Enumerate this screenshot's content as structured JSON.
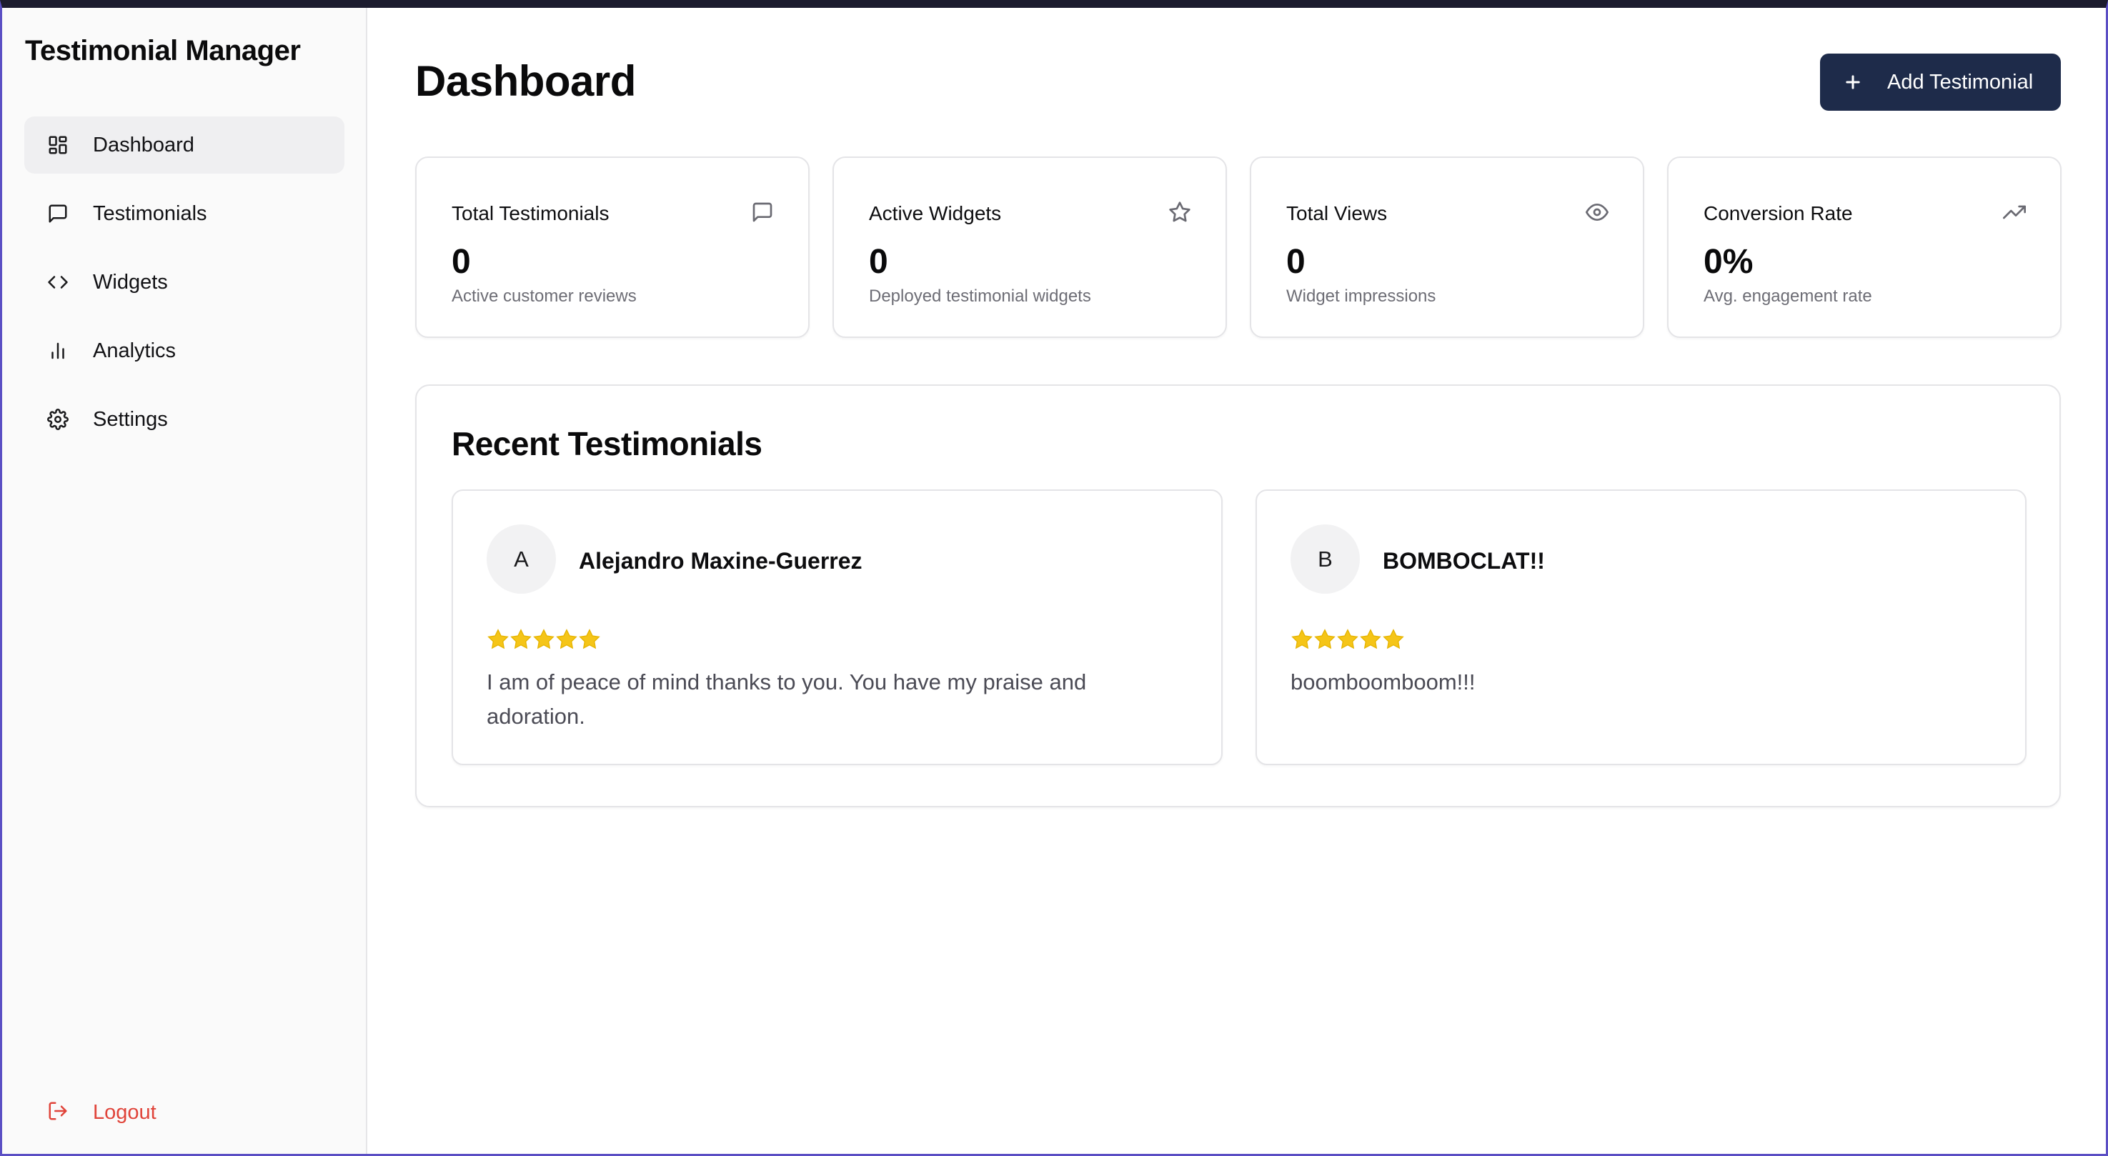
{
  "app": {
    "title": "Testimonial Manager"
  },
  "sidebar": {
    "items": [
      {
        "label": "Dashboard",
        "icon": "dashboard-grid-icon",
        "active": true
      },
      {
        "label": "Testimonials",
        "icon": "message-square-icon",
        "active": false
      },
      {
        "label": "Widgets",
        "icon": "code-icon",
        "active": false
      },
      {
        "label": "Analytics",
        "icon": "bar-chart-icon",
        "active": false
      },
      {
        "label": "Settings",
        "icon": "gear-icon",
        "active": false
      }
    ],
    "logout_label": "Logout"
  },
  "header": {
    "title": "Dashboard",
    "add_button_label": "Add Testimonial"
  },
  "stats": [
    {
      "title": "Total Testimonials",
      "value": "0",
      "subtitle": "Active customer reviews",
      "icon": "message-square-icon"
    },
    {
      "title": "Active Widgets",
      "value": "0",
      "subtitle": "Deployed testimonial widgets",
      "icon": "star-icon"
    },
    {
      "title": "Total Views",
      "value": "0",
      "subtitle": "Widget impressions",
      "icon": "eye-icon"
    },
    {
      "title": "Conversion Rate",
      "value": "0%",
      "subtitle": "Avg. engagement rate",
      "icon": "trending-up-icon"
    }
  ],
  "recent": {
    "title": "Recent Testimonials",
    "items": [
      {
        "initial": "A",
        "name": "Alejandro Maxine-Guerrez",
        "rating": 5,
        "text": "I am of peace of mind thanks to you. You have my praise and adoration."
      },
      {
        "initial": "B",
        "name": "BOMBOCLAT!!",
        "rating": 5,
        "text": "boomboomboom!!!"
      }
    ]
  },
  "colors": {
    "primary_button": "#1e2b4a",
    "logout": "#e0443a",
    "star": "#f5c518",
    "active_nav_bg": "#efeff1"
  }
}
